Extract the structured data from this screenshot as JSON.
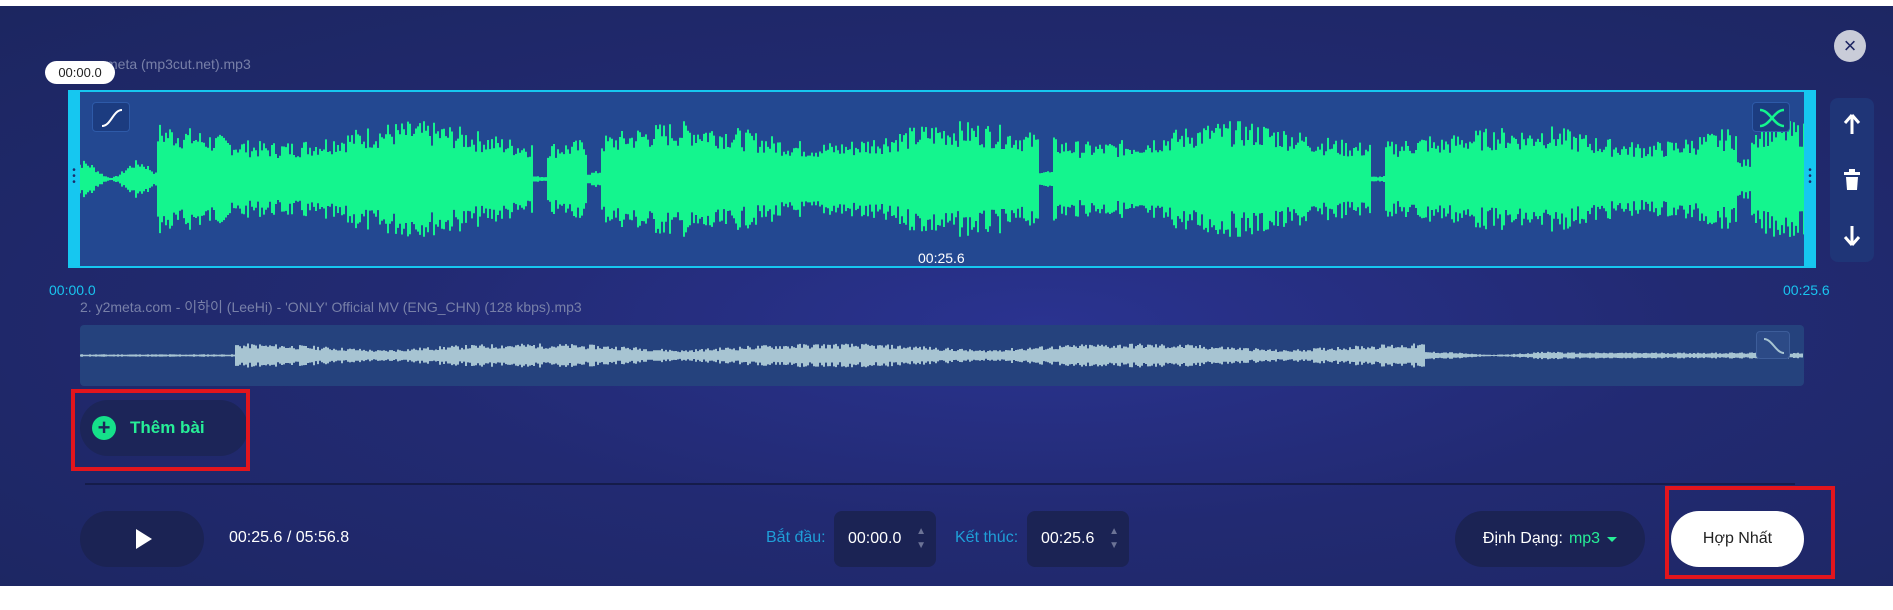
{
  "close_label": "×",
  "track1": {
    "file_label": "meta (mp3cut.net).mp3",
    "playhead_time": "00:00.0",
    "center_time": "00:25.6",
    "start_time": "00:00.0",
    "end_time": "00:25.6",
    "wave_color": "#14f58e"
  },
  "track2": {
    "file_label": "2. y2meta.com - 이하이 (LeeHi) - 'ONLY' Official MV (ENG_CHN) (128 kbps).mp3",
    "wave_color": "#a7c4d2"
  },
  "add_track": {
    "label": "Thêm bài",
    "icon": "plus-circle-icon"
  },
  "player": {
    "position": "00:25.6 / 05:56.8",
    "start_label": "Bắt đầu:",
    "start_value": "00:00.0",
    "end_label": "Kết thúc:",
    "end_value": "00:25.6"
  },
  "format": {
    "label": "Định Dạng:",
    "value": "mp3"
  },
  "merge_label": "Hợp Nhất",
  "side_icons": [
    "arrow-up-icon",
    "trash-icon",
    "arrow-down-icon"
  ],
  "colors": {
    "accent": "#16c7f0",
    "green": "#27ee97",
    "highlight": "#e2151d"
  }
}
